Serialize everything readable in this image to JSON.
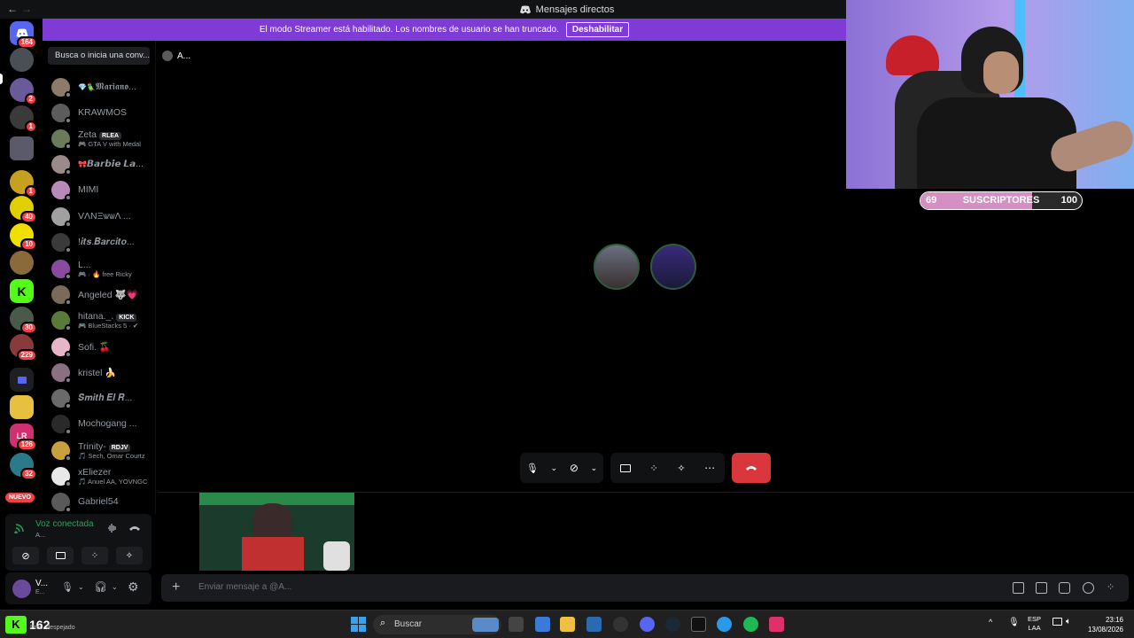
{
  "titlebar": {
    "title": "Mensajes directos"
  },
  "banner": {
    "text": "El modo Streamer está habilitado. Los nombres de usuario se han truncado.",
    "button": "Deshabilitar"
  },
  "rail": {
    "home_badge": "164",
    "servers": [
      {
        "badge": ""
      },
      {
        "badge": "2"
      },
      {
        "badge": "1"
      },
      {
        "badge": ""
      },
      {
        "badge": "1"
      },
      {
        "badge": "40"
      },
      {
        "badge": "10"
      },
      {
        "badge": ""
      },
      {
        "badge": ""
      },
      {
        "badge": "30"
      },
      {
        "badge": "229"
      },
      {
        "badge": ""
      },
      {
        "badge": ""
      },
      {
        "badge": "126"
      },
      {
        "badge": "32"
      }
    ],
    "new_label": "NUEVO"
  },
  "dm_search": {
    "placeholder": "Busca o inicia una conv..."
  },
  "dms": [
    {
      "name": "𝕸𝖆𝖗𝖎𝖆𝖓𝖔...",
      "prefix": "💎🦜",
      "sub": "",
      "tag": "",
      "color": "#8c7b6a"
    },
    {
      "name": "KRAWMOS",
      "prefix": "",
      "sub": "",
      "tag": "",
      "color": "#5c5c5c"
    },
    {
      "name": "Zeta",
      "prefix": "",
      "sub": "🎮 GTA V with Medal",
      "tag": "RLEA",
      "color": "#6a7a5a"
    },
    {
      "name": "𝘽𝙖𝙧𝙗𝙞𝙚 𝙇𝙖...",
      "prefix": "🎀",
      "sub": "",
      "tag": "",
      "color": "#9a8a8a"
    },
    {
      "name": "MIMI",
      "prefix": "",
      "sub": "",
      "tag": "",
      "color": "#b88ab8"
    },
    {
      "name": "VΛNΞѡѡΛ ...",
      "prefix": "",
      "sub": "",
      "tag": "",
      "color": "#a0a0a0"
    },
    {
      "name": "!𝒊𝒕𝒔.𝑩𝒂𝒓𝒄𝒊𝒕𝒐...",
      "prefix": "",
      "sub": "",
      "tag": "",
      "color": "#3a3a3a"
    },
    {
      "name": "L...",
      "prefix": "",
      "sub": "🎮 · 🔥 free Ricky",
      "tag": "",
      "color": "#8a4aa0"
    },
    {
      "name": "Angeled 🐺💗",
      "prefix": "",
      "sub": "",
      "tag": "",
      "color": "#7a6a5a"
    },
    {
      "name": "hitana._.",
      "prefix": "",
      "sub": "🎮 BlueStacks 5 · ✔",
      "tag": "KICK",
      "color": "#5a7a3a"
    },
    {
      "name": "Sofi. 🍒",
      "prefix": "",
      "sub": "",
      "tag": "",
      "color": "#e8b4c8"
    },
    {
      "name": "kristel 🍌",
      "prefix": "",
      "sub": "",
      "tag": "",
      "color": "#8a7080"
    },
    {
      "name": "𝑺𝒎𝒊𝒕𝒉 𝑬𝒍 𝑹...",
      "prefix": "",
      "sub": "",
      "tag": "",
      "color": "#6a6a6a"
    },
    {
      "name": "Mochogang ...",
      "prefix": "",
      "sub": "",
      "tag": "",
      "color": "#2a2a2a"
    },
    {
      "name": "Trinity-",
      "prefix": "",
      "sub": "🎵 Sech, Omar Courtz",
      "tag": "RDJV",
      "color": "#c8a040"
    },
    {
      "name": "xEliezer",
      "prefix": "",
      "sub": "🎵 Anuel AA, YOVNGC",
      "tag": "",
      "color": "#e8e8e8"
    },
    {
      "name": "Gabriel54",
      "prefix": "",
      "sub": "",
      "tag": "",
      "color": "#5a5a5a"
    }
  ],
  "voice": {
    "status": "Voz conectada",
    "channel": "A..."
  },
  "user": {
    "name": "V...",
    "sub": "E..."
  },
  "call": {
    "header": "A..."
  },
  "message": {
    "placeholder": "Enviar mensaje a @A..."
  },
  "overlay": {
    "left": "69",
    "label": "SUSCRIPTORES",
    "right": "100",
    "progress": 0.69
  },
  "taskbar": {
    "weather_temp": "162",
    "weather_text": "Prec. despejado",
    "search": "Buscar",
    "lang1": "ESP",
    "lang2": "LAA",
    "time": "23:16",
    "date": "13/08/2026"
  },
  "colors": {
    "accent": "#7e3bd6",
    "hangup": "#da373c",
    "online": "#23a55a",
    "badge": "#f23f43"
  }
}
